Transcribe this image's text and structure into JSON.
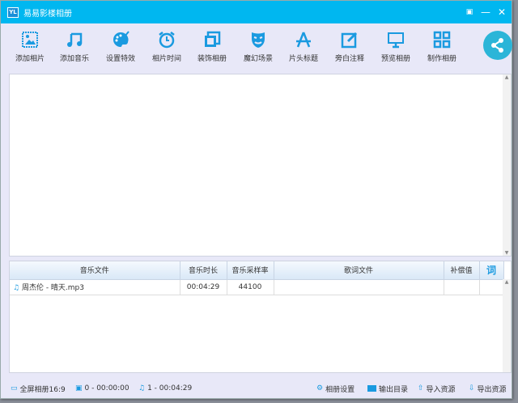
{
  "window": {
    "logo": "YL",
    "title": "易易影楼相册"
  },
  "toolbar": {
    "items": [
      {
        "label": "添加相片",
        "icon": "image-icon"
      },
      {
        "label": "添加音乐",
        "icon": "music-icon"
      },
      {
        "label": "设置特效",
        "icon": "palette-icon"
      },
      {
        "label": "相片时间",
        "icon": "alarm-clock-icon"
      },
      {
        "label": "装饰相册",
        "icon": "layers-icon"
      },
      {
        "label": "魔幻场景",
        "icon": "mask-icon"
      },
      {
        "label": "片头标题",
        "icon": "title-a-icon"
      },
      {
        "label": "旁白注释",
        "icon": "edit-icon"
      },
      {
        "label": "预览相册",
        "icon": "monitor-icon"
      },
      {
        "label": "制作相册",
        "icon": "grid-icon"
      }
    ]
  },
  "music_table": {
    "headers": [
      "音乐文件",
      "音乐时长",
      "音乐采样率",
      "歌词文件",
      "补偿值",
      "词"
    ],
    "rows": [
      {
        "file": "周杰伦 - 晴天.mp3",
        "duration": "00:04:29",
        "sample_rate": "44100",
        "lyrics": "",
        "offset": ""
      }
    ]
  },
  "status": {
    "aspect": "全屏相册16:9",
    "photos": "0 - 00:00:00",
    "music": "1 - 00:04:29",
    "settings": "相册设置",
    "output": "输出目录",
    "import": "导入资源",
    "export": "导出资源"
  },
  "colors": {
    "accent": "#00b7f0",
    "icon": "#1a9ae0"
  }
}
